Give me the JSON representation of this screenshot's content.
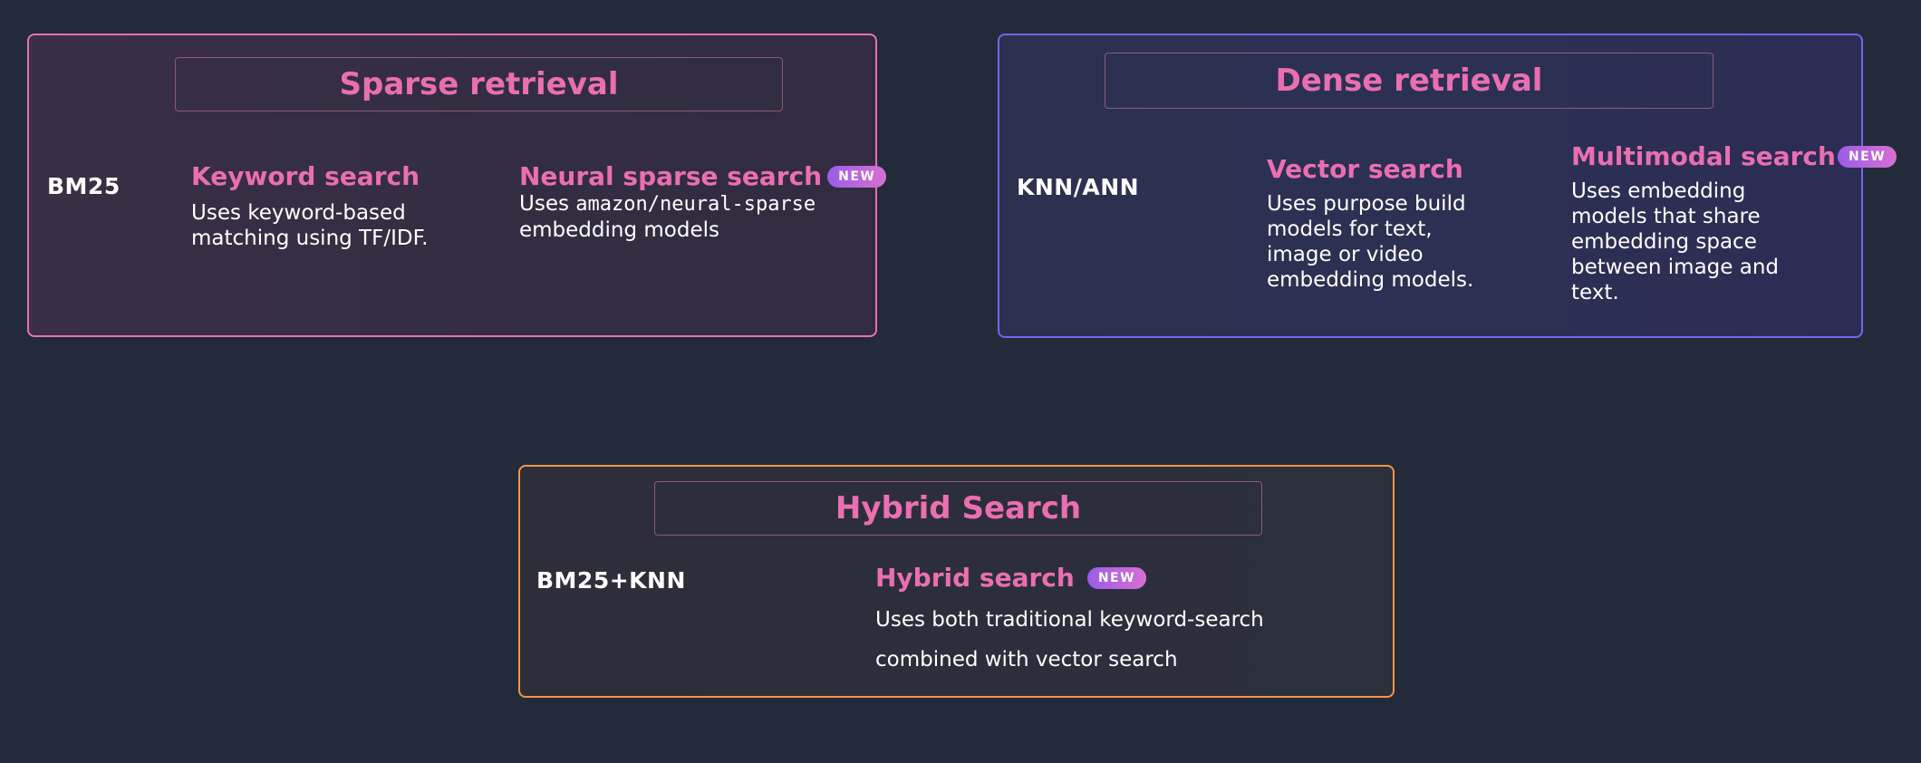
{
  "sparse": {
    "title": "Sparse retrieval",
    "method": "BM25",
    "items": [
      {
        "title": "Keyword search",
        "desc": "Uses keyword-based matching using TF/IDF."
      },
      {
        "title": "Neural sparse search",
        "badge": "NEW",
        "desc_prefix": "Uses",
        "desc_code": "amazon/neural-sparse",
        "desc_suffix": "embedding models"
      }
    ]
  },
  "dense": {
    "title": "Dense retrieval",
    "method": "KNN/ANN",
    "items": [
      {
        "title": "Vector search",
        "desc": "Uses purpose build models for text, image or video  embedding models."
      },
      {
        "title": "Multimodal search",
        "badge": "NEW",
        "desc": "Uses embedding models that share embedding space between image and text."
      }
    ]
  },
  "hybrid": {
    "title": "Hybrid Search",
    "method": "BM25+KNN",
    "items": [
      {
        "title": "Hybrid search",
        "badge": "NEW",
        "desc_line1": "Uses both traditional keyword-search",
        "desc_line2": "combined with vector search"
      }
    ]
  },
  "colors": {
    "background": "#232b3a",
    "accent_pink": "#ea6fb0",
    "sparse_border": "#ea6fb0",
    "dense_border": "#7266ee",
    "hybrid_border": "#f0964a"
  }
}
